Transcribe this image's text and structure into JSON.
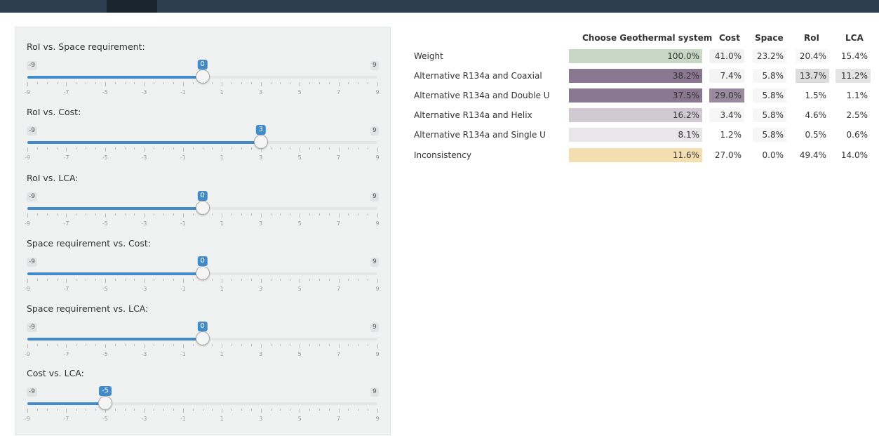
{
  "sliders": [
    {
      "label": "RoI vs. Space requirement:",
      "min_label": "-9",
      "max_label": "9",
      "value": 0,
      "min": -9,
      "max": 9
    },
    {
      "label": "RoI vs. Cost:",
      "min_label": "-9",
      "max_label": "9",
      "value": 3,
      "min": -9,
      "max": 9
    },
    {
      "label": "RoI vs. LCA:",
      "min_label": "-9",
      "max_label": "9",
      "value": 0,
      "min": -9,
      "max": 9
    },
    {
      "label": "Space requirement vs. Cost:",
      "min_label": "-9",
      "max_label": "9",
      "value": 0,
      "min": -9,
      "max": 9
    },
    {
      "label": "Space requirement vs. LCA:",
      "min_label": "-9",
      "max_label": "9",
      "value": 0,
      "min": -9,
      "max": 9
    },
    {
      "label": "Cost vs. LCA:",
      "min_label": "-9",
      "max_label": "9",
      "value": -5,
      "min": -9,
      "max": 9
    }
  ],
  "tick_labels": [
    "-9",
    "-7",
    "-5",
    "-3",
    "-1",
    "1",
    "3",
    "5",
    "7",
    "9"
  ],
  "table": {
    "headers": [
      "Choose Geothermal system",
      "Cost",
      "Space",
      "RoI",
      "LCA"
    ],
    "rows": [
      {
        "label": "Weight",
        "cells": [
          "100.0%",
          "41.0%",
          "23.2%",
          "20.4%",
          "15.4%"
        ]
      },
      {
        "label": "Alternative R134a and Coaxial",
        "cells": [
          "38.2%",
          "7.4%",
          "5.8%",
          "13.7%",
          "11.2%"
        ]
      },
      {
        "label": "Alternative R134a and Double U",
        "cells": [
          "37.5%",
          "29.0%",
          "5.8%",
          "1.5%",
          "1.1%"
        ]
      },
      {
        "label": "Alternative R134a and Helix",
        "cells": [
          "16.2%",
          "3.4%",
          "5.8%",
          "4.6%",
          "2.5%"
        ]
      },
      {
        "label": "Alternative R134a and Single U",
        "cells": [
          "8.1%",
          "1.2%",
          "5.8%",
          "0.5%",
          "0.6%"
        ]
      },
      {
        "label": "Inconsistency",
        "cells": [
          "11.6%",
          "27.0%",
          "0.0%",
          "49.4%",
          "14.0%"
        ]
      }
    ],
    "cell_colors": [
      [
        "#c9d8c5",
        "#f2f2f2",
        "#f7f7f7",
        "#f9f9f9",
        "#ffffff"
      ],
      [
        "#8a7790",
        "#f4f4f4",
        "#f6f6f6",
        "#dddddd",
        "#e5e5e5"
      ],
      [
        "#8a7790",
        "#9a8aa0",
        "#f6f6f6",
        "#ffffff",
        "#ffffff"
      ],
      [
        "#d0c9d2",
        "#f6f6f6",
        "#f6f6f6",
        "#ffffff",
        "#ffffff"
      ],
      [
        "#e9e6ea",
        "#ffffff",
        "#f6f6f6",
        "#ffffff",
        "#ffffff"
      ],
      [
        "#f4deb0",
        "#ffffff",
        "#ffffff",
        "#ffffff",
        "#ffffff"
      ]
    ]
  },
  "colors": {
    "topbar": "#2c3e50",
    "slider_accent": "#428bca"
  }
}
